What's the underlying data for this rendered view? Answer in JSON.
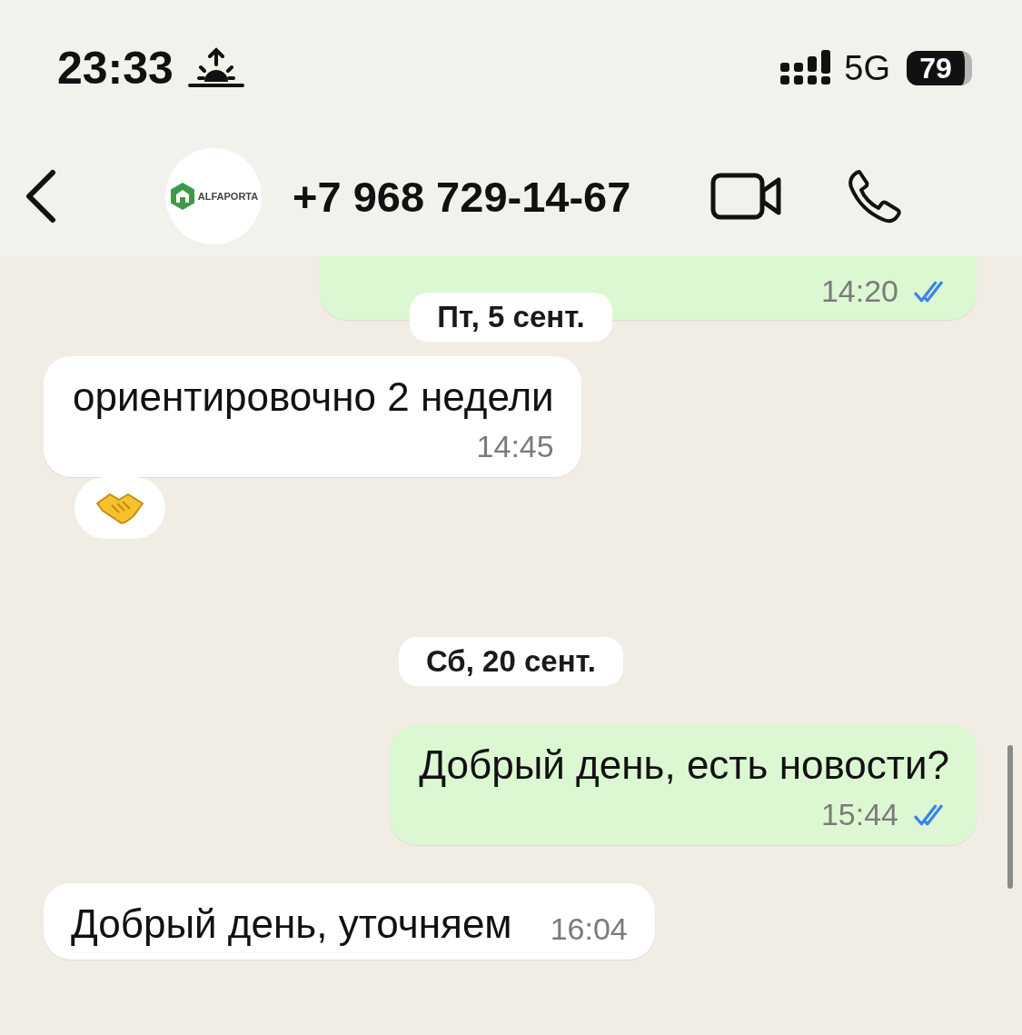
{
  "status_bar": {
    "time": "23:33",
    "network": "5G",
    "battery": "79"
  },
  "header": {
    "contact": "+7 968 729-14-67",
    "avatar_text": "ALFAPORTA"
  },
  "messages": [
    {
      "kind": "outgoing",
      "time": "14:20",
      "read": true,
      "partial": true
    },
    {
      "kind": "date",
      "text": "Пт, 5 сент."
    },
    {
      "kind": "incoming",
      "text": "ориентировочно 2 недели",
      "time": "14:45",
      "reacted": true,
      "inline_time": false
    },
    {
      "kind": "date",
      "text": "Сб, 20 сент."
    },
    {
      "kind": "outgoing",
      "text": "Добрый день, есть новости?",
      "time": "15:44",
      "read": true
    },
    {
      "kind": "incoming",
      "text": "Добрый день, уточняем",
      "time": "16:04",
      "inline_time": true
    }
  ]
}
